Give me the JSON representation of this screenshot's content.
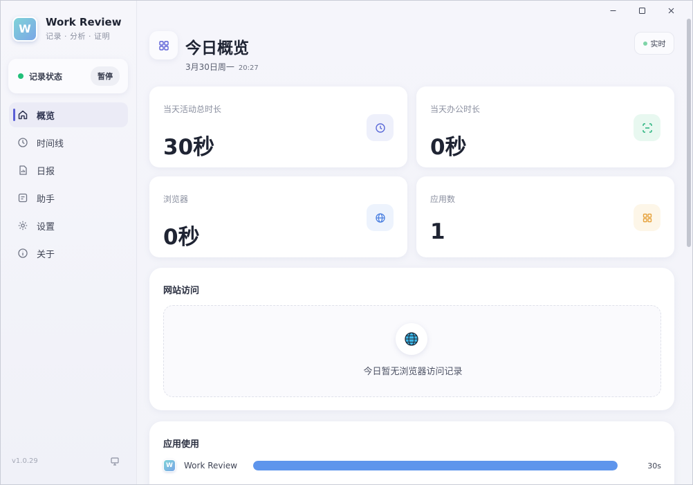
{
  "window": {
    "controls": {
      "minimize": "minimize-icon",
      "maximize": "maximize-icon",
      "close": "close-icon"
    }
  },
  "sidebar": {
    "app_name": "Work Review",
    "app_subtitle": "记录 · 分析 · 证明",
    "logo_text": "W",
    "status": {
      "label": "记录状态",
      "pause_label": "暂停",
      "dot_color": "#22c07a"
    },
    "items": [
      {
        "label": "概览",
        "icon": "home-icon",
        "active": true
      },
      {
        "label": "时间线",
        "icon": "clock-icon",
        "active": false
      },
      {
        "label": "日报",
        "icon": "report-icon",
        "active": false
      },
      {
        "label": "助手",
        "icon": "assistant-icon",
        "active": false
      },
      {
        "label": "设置",
        "icon": "gear-icon",
        "active": false
      },
      {
        "label": "关于",
        "icon": "info-icon",
        "active": false
      }
    ],
    "version": "v1.0.29"
  },
  "header": {
    "title": "今日概览",
    "date": "3月30日周一",
    "time": "20:27",
    "realtime_label": "实时"
  },
  "stats": [
    {
      "label": "当天活动总时长",
      "value": "30秒",
      "icon": "clock-icon",
      "accent": "#5b6ad8"
    },
    {
      "label": "当天办公时长",
      "value": "0秒",
      "icon": "scan-icon",
      "accent": "#22b07a"
    },
    {
      "label": "浏览器",
      "value": "0秒",
      "icon": "globe-icon",
      "accent": "#4a7fe0"
    },
    {
      "label": "应用数",
      "value": "1",
      "icon": "grid-icon",
      "accent": "#e6a23c"
    }
  ],
  "websites": {
    "title": "网站访问",
    "empty_text": "今日暂无浏览器访问记录"
  },
  "apps": {
    "title": "应用使用",
    "items": [
      {
        "name": "Work Review",
        "logo_text": "W",
        "duration": "30s",
        "share": 1.0
      }
    ]
  },
  "colors": {
    "accent": "#5b5fd6",
    "bar": "#5e95ec"
  }
}
